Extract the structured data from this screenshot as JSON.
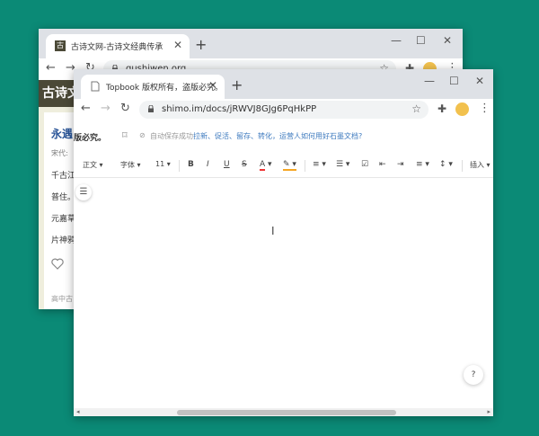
{
  "back_window": {
    "tab_title": "古诗文网-古诗文经典传承",
    "url": "gushiwen.org",
    "header_logo": "古诗文",
    "poem_title": "永遇",
    "dynasty_label": "宋代:",
    "lines": [
      "千古江",
      "普住。",
      "元嘉草",
      "片神鸦"
    ],
    "footer": "高中古"
  },
  "front_window": {
    "tab_title": "Topbook 版权所有，盗版必究。",
    "url": "shimo.im/docs/jRWVJ8GJg6PqHkPP",
    "doc_title": "版必究。",
    "autosave": "自动保存成功",
    "promo": "拉新、促活、留存、转化，运营人如何用好石墨文档?",
    "toolbar": {
      "style": "正文",
      "font": "字体",
      "size": "11",
      "bold": "B",
      "italic": "I",
      "underline": "U",
      "strike": "S",
      "color": "A",
      "insert": "插入"
    }
  },
  "colors": {
    "desktop": "#0b8a76",
    "brand_green": "#4b4937"
  }
}
